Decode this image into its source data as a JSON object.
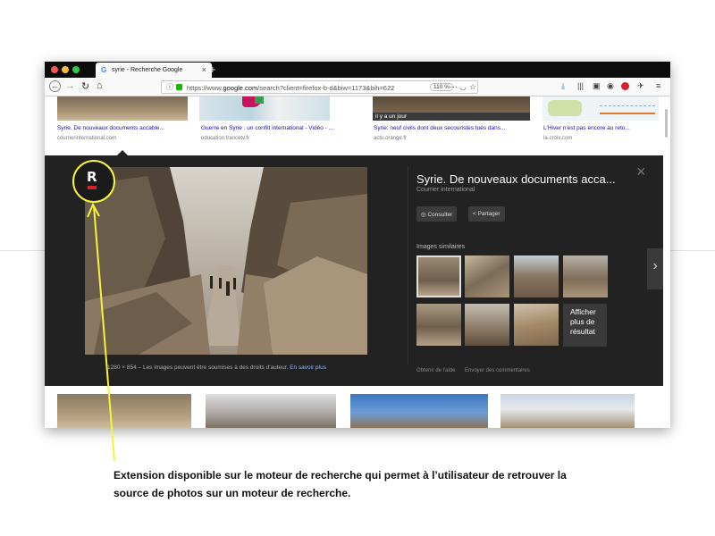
{
  "window": {
    "tab_title": "syrie - Recherche Google",
    "favicon_letter": "G",
    "tab_close": "×",
    "new_tab": "+"
  },
  "navbar": {
    "url_prefix": "https://www.",
    "url_domain": "google.com",
    "url_rest": "/search?client=firefox-b-d&biw=1173&bih=622",
    "zoom": "110 %"
  },
  "results": [
    {
      "caption": "Syrie. De nouveaux documents accable...",
      "source": "courrierinternational.com"
    },
    {
      "caption": "Guerre en Syrie : un conflit international - Vidéo - ...",
      "source": "education.francetv.fr"
    },
    {
      "caption": "Syrie: neuf civils dont deux secouristes tués dans...",
      "source": "actu.orange.fr",
      "overlay": "il y a un jour"
    },
    {
      "caption": "L'Hiver n'est pas encore au reto...",
      "source": "la-croix.com"
    }
  ],
  "panel": {
    "title": "Syrie. De nouveaux documents acca...",
    "source": "Courrier international",
    "consult_button": "Consulter",
    "share_button": "Partager",
    "similar_label": "Images similaires",
    "more_label": "Afficher plus de résultat",
    "image_dims": "1280 × 854",
    "copyright": "Les images peuvent être soumises à des droits d'auteur.",
    "learn_more": "En savoir plus",
    "help": "Obtenir de l'aide",
    "feedback": "Envoyer des commentaires",
    "close": "×",
    "next": "›"
  },
  "extension": {
    "letter": "R"
  },
  "annotation": {
    "text": "Extension disponible sur le moteur de recherche qui permet à l’utilisateur de retrouver la source de photos sur un moteur de recherche.",
    "color": "#f6f43a"
  },
  "colors": {
    "dark_panel": "#222222",
    "traffic_red": "#fc5753",
    "traffic_yellow": "#fdbc40",
    "traffic_green": "#33c748"
  }
}
